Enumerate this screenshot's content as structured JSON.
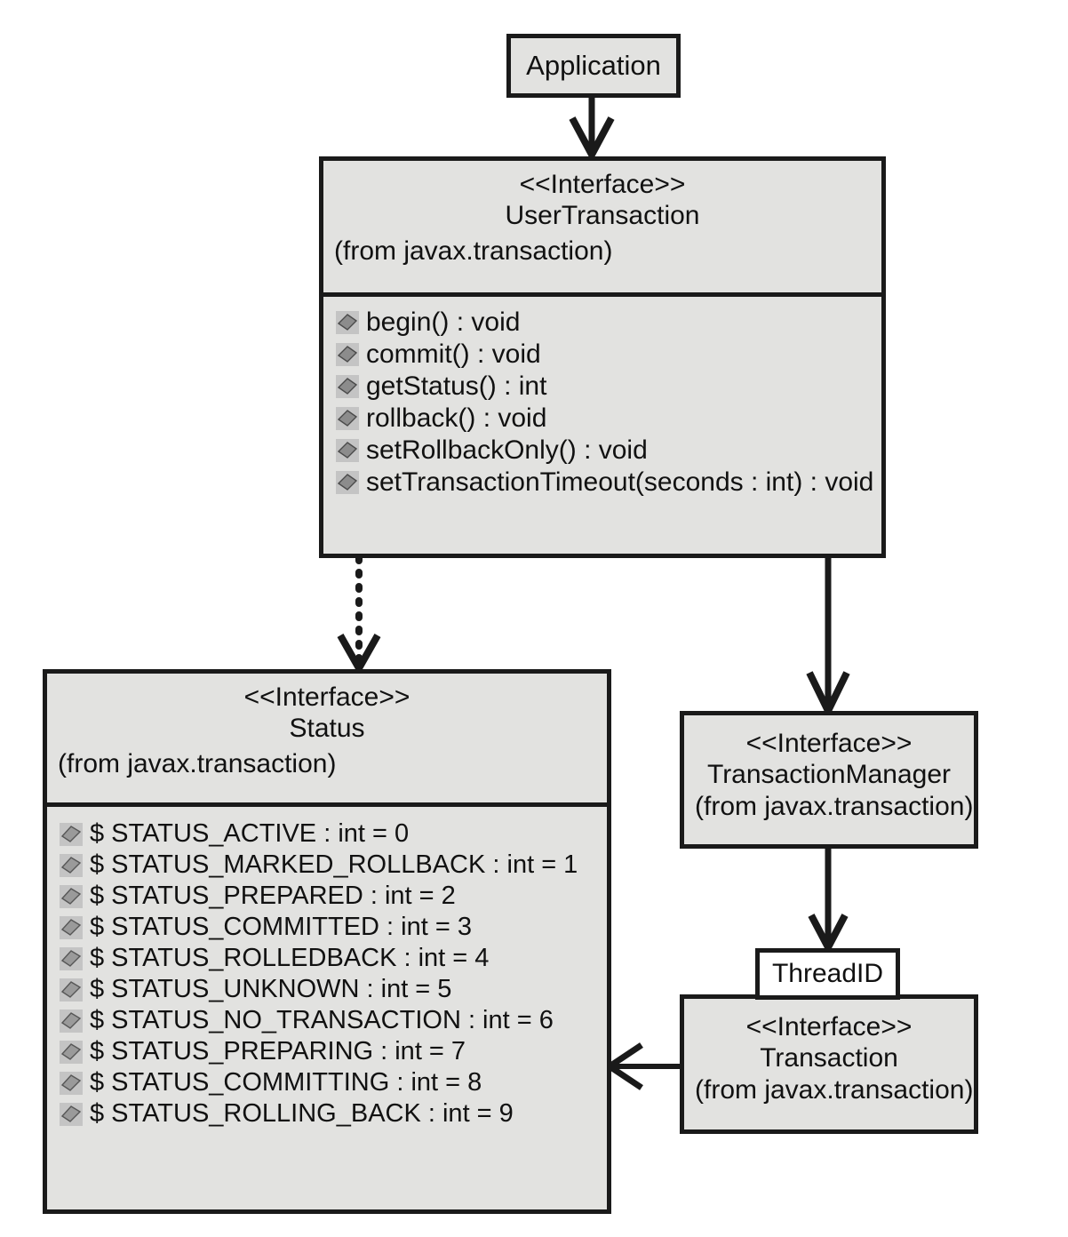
{
  "diagram": {
    "title": "JTA transaction interfaces class diagram",
    "palette": {
      "box_fill": "#e2e2e0",
      "box_border": "#1a1a1a",
      "plain_fill": "#ffffff",
      "icon_fill": "#8c8c8c",
      "icon_bg": "#c4c4c4",
      "background": "#ffffff"
    }
  },
  "nodes": {
    "application": {
      "name": "Application"
    },
    "user_transaction": {
      "stereotype": "<<Interface>>",
      "name": "UserTransaction",
      "package": "(from javax.transaction)",
      "methods": [
        {
          "icon": "method-diamond-icon",
          "label": "begin() : void"
        },
        {
          "icon": "method-diamond-icon",
          "label": "commit() : void"
        },
        {
          "icon": "method-diamond-icon",
          "label": "getStatus() : int"
        },
        {
          "icon": "method-diamond-icon",
          "label": "rollback() : void"
        },
        {
          "icon": "method-diamond-icon",
          "label": "setRollbackOnly() : void"
        },
        {
          "icon": "method-diamond-icon",
          "label": "setTransactionTimeout(seconds : int) : void"
        }
      ]
    },
    "status": {
      "stereotype": "<<Interface>>",
      "name": "Status",
      "package": "(from javax.transaction)",
      "attributes": [
        {
          "icon": "attribute-diamond-icon",
          "label": "$ STATUS_ACTIVE : int = 0"
        },
        {
          "icon": "attribute-diamond-icon",
          "label": "$ STATUS_MARKED_ROLLBACK : int = 1"
        },
        {
          "icon": "attribute-diamond-icon",
          "label": "$ STATUS_PREPARED : int = 2"
        },
        {
          "icon": "attribute-diamond-icon",
          "label": "$ STATUS_COMMITTED : int = 3"
        },
        {
          "icon": "attribute-diamond-icon",
          "label": "$ STATUS_ROLLEDBACK : int = 4"
        },
        {
          "icon": "attribute-diamond-icon",
          "label": "$ STATUS_UNKNOWN : int = 5"
        },
        {
          "icon": "attribute-diamond-icon",
          "label": "$ STATUS_NO_TRANSACTION : int = 6"
        },
        {
          "icon": "attribute-diamond-icon",
          "label": "$ STATUS_PREPARING : int = 7"
        },
        {
          "icon": "attribute-diamond-icon",
          "label": "$ STATUS_COMMITTING : int = 8"
        },
        {
          "icon": "attribute-diamond-icon",
          "label": "$ STATUS_ROLLING_BACK : int = 9"
        }
      ]
    },
    "transaction_manager": {
      "stereotype": "<<Interface>>",
      "name": "TransactionManager",
      "package": "(from javax.transaction)"
    },
    "thread_id": {
      "name": "ThreadID"
    },
    "transaction": {
      "stereotype": "<<Interface>>",
      "name": "Transaction",
      "package": "(from javax.transaction)"
    }
  },
  "edges": [
    {
      "id": "application-to-usertransaction",
      "from": "Application",
      "to": "UserTransaction",
      "style": "solid",
      "arrow": "open"
    },
    {
      "id": "usertransaction-to-status",
      "from": "UserTransaction",
      "to": "Status",
      "style": "dotted",
      "arrow": "open"
    },
    {
      "id": "usertransaction-to-transactionmanager",
      "from": "UserTransaction",
      "to": "TransactionManager",
      "style": "solid",
      "arrow": "open"
    },
    {
      "id": "transactionmanager-to-threadid",
      "from": "TransactionManager",
      "to": "ThreadID",
      "style": "solid",
      "arrow": "open"
    },
    {
      "id": "transaction-to-status",
      "from": "Transaction",
      "to": "Status",
      "style": "solid",
      "arrow": "open"
    }
  ]
}
